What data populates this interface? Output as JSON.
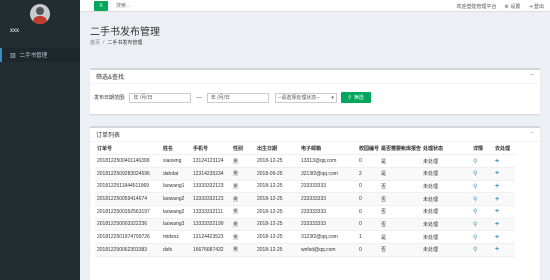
{
  "sidebar": {
    "username": "xxx",
    "menu_item": "二手书管理"
  },
  "topbar": {
    "toggle_icon": "menu-icon",
    "search_placeholder": "搜索...",
    "welcome": "欢迎登陆管理平台",
    "settings_label": "设置",
    "logout_label": "登出"
  },
  "page": {
    "title": "二手书发布管理",
    "breadcrumb": [
      "首页",
      "二手书发布管理"
    ]
  },
  "filter": {
    "box_title": "筛选&查找",
    "label": "发布日期范围:",
    "date_start_placeholder": "年 /月/日",
    "date_end_placeholder": "年 /月/日",
    "separator": "—",
    "status_select": "--请选择处理状态--",
    "button": "筛选"
  },
  "orders": {
    "box_title": "订单列表",
    "headers": [
      "订单号",
      "姓名",
      "手机号",
      "性别",
      "出生日期",
      "电子邮箱",
      "校园编号",
      "是否需要帐库报告",
      "处理状态",
      "详情",
      "去处理"
    ],
    "rows": [
      [
        "20181225004011463​99",
        "xiaowng",
        "13124123124",
        "男",
        "2018-12-25",
        "13313@qq.com",
        "0",
        "是",
        "未处理"
      ],
      [
        "20181225092830245​96",
        "dahdat",
        "12314235234",
        "男",
        "2018-09-25",
        "3213f2@qq.com",
        "2",
        "是",
        "未处理"
      ],
      [
        "20181225118445​11969",
        "laowang1",
        "13333332123",
        "男",
        "2018-12-25",
        "233333333",
        "0",
        "否",
        "未处理"
      ],
      [
        "20181225005941​4674",
        "laowang2",
        "13333332123",
        "男",
        "2018-12-25",
        "233333333",
        "0",
        "否",
        "未处理"
      ],
      [
        "2018122500392563​197",
        "laowang2",
        "13333332111",
        "男",
        "2018-12-25",
        "233333333",
        "0",
        "否",
        "未处理"
      ],
      [
        "2018122500033222​36",
        "laowang3",
        "13333332199",
        "男",
        "2018-12-25",
        "233333333",
        "0",
        "否",
        "未处理"
      ],
      [
        "20181225019747​99726",
        "midsnz",
        "13124423523",
        "男",
        "2018-12-25",
        "3123f2@qq.com",
        "1",
        "是",
        "未处理"
      ],
      [
        "2018122500623033​83",
        "dsfs",
        "16676687432",
        "男",
        "2018-12-25",
        "wefsd@qq.com",
        "0",
        "否",
        "未处理"
      ]
    ]
  }
}
